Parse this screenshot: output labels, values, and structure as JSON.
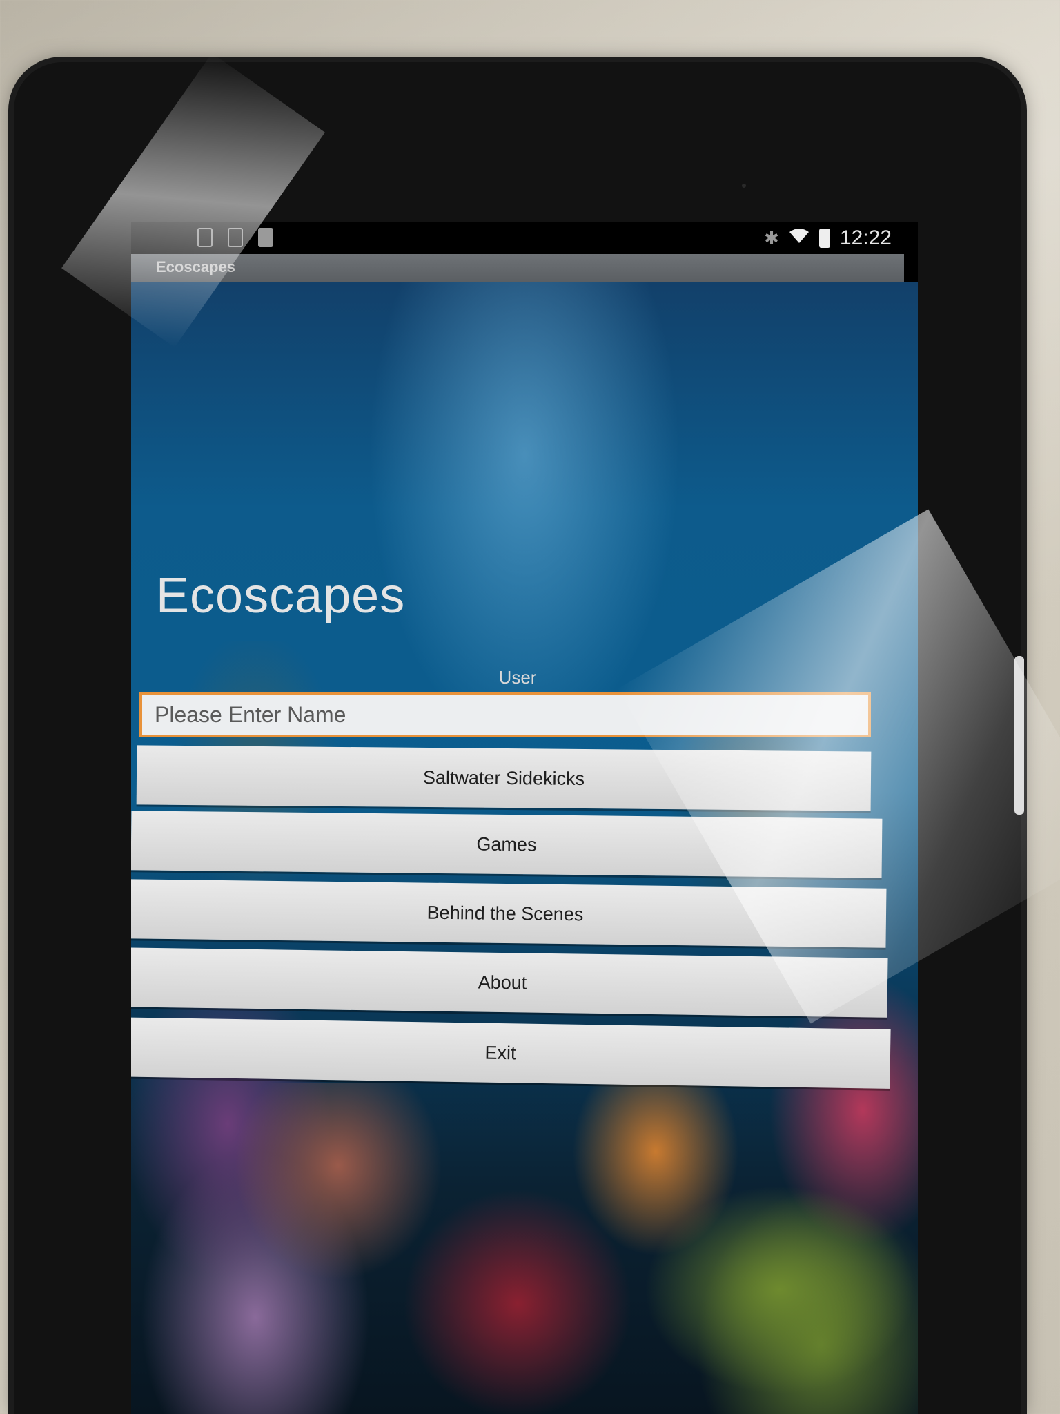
{
  "status_bar": {
    "time": "12:22",
    "icons": [
      "notification-icon",
      "notification-icon",
      "notification-icon",
      "bluetooth-icon",
      "wifi-icon",
      "battery-charging-icon"
    ]
  },
  "app_bar": {
    "title": "Ecoscapes"
  },
  "main": {
    "title": "Ecoscapes",
    "user_label": "User",
    "name_input": {
      "placeholder": "Please Enter Name",
      "value": ""
    },
    "buttons": [
      {
        "label": "Saltwater Sidekicks"
      },
      {
        "label": "Games"
      },
      {
        "label": "Behind the Scenes"
      },
      {
        "label": "About"
      },
      {
        "label": "Exit"
      }
    ]
  },
  "colors": {
    "input_border": "#e8923a",
    "button_bg": "#e0e0e0",
    "ocean_blue": "#0b5d8e"
  }
}
